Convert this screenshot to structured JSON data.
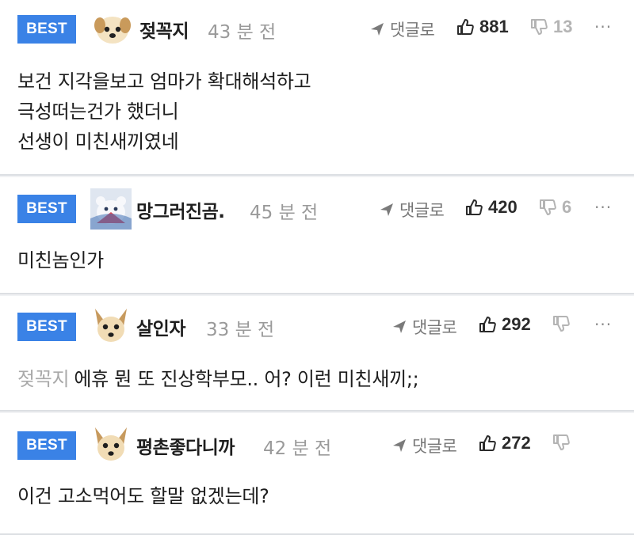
{
  "comments": [
    {
      "badge": "BEST",
      "nickname": "젖꼭지",
      "time": "43 분 전",
      "reply_label": "댓글로",
      "likes": "881",
      "dislikes": "13",
      "more": "···",
      "avatar_icon": "dog-avatar-icon",
      "lines": [
        "보건 지각을보고 엄마가 확대해석하고",
        "극성떠는건가 했더니",
        "선생이 미친새끼였네"
      ]
    },
    {
      "badge": "BEST",
      "nickname": "망그러진곰.",
      "time": "45 분 전",
      "reply_label": "댓글로",
      "likes": "420",
      "dislikes": "6",
      "more": "···",
      "avatar_icon": "polar-bear-avatar-icon",
      "lines": [
        "미친놈인가"
      ]
    },
    {
      "badge": "BEST",
      "nickname": "살인자",
      "time": "33 분 전",
      "reply_label": "댓글로",
      "likes": "292",
      "dislikes": "",
      "more": "···",
      "avatar_icon": "chihuahua-avatar-icon",
      "mention": "젖꼭지",
      "lines": [
        "에휴 뭔 또 진상학부모.. 어? 이런 미친새끼;;"
      ]
    },
    {
      "badge": "BEST",
      "nickname": "평촌좋다니까",
      "time": "42 분 전",
      "reply_label": "댓글로",
      "likes": "272",
      "dislikes": "",
      "more": "",
      "avatar_icon": "chihuahua-avatar-icon",
      "lines": [
        "이건 고소먹어도 할말 없겠는데?"
      ]
    }
  ],
  "colors": {
    "badge": "#3a82e6",
    "muted": "#9a9a9a",
    "separator": "#dcdfe3"
  }
}
